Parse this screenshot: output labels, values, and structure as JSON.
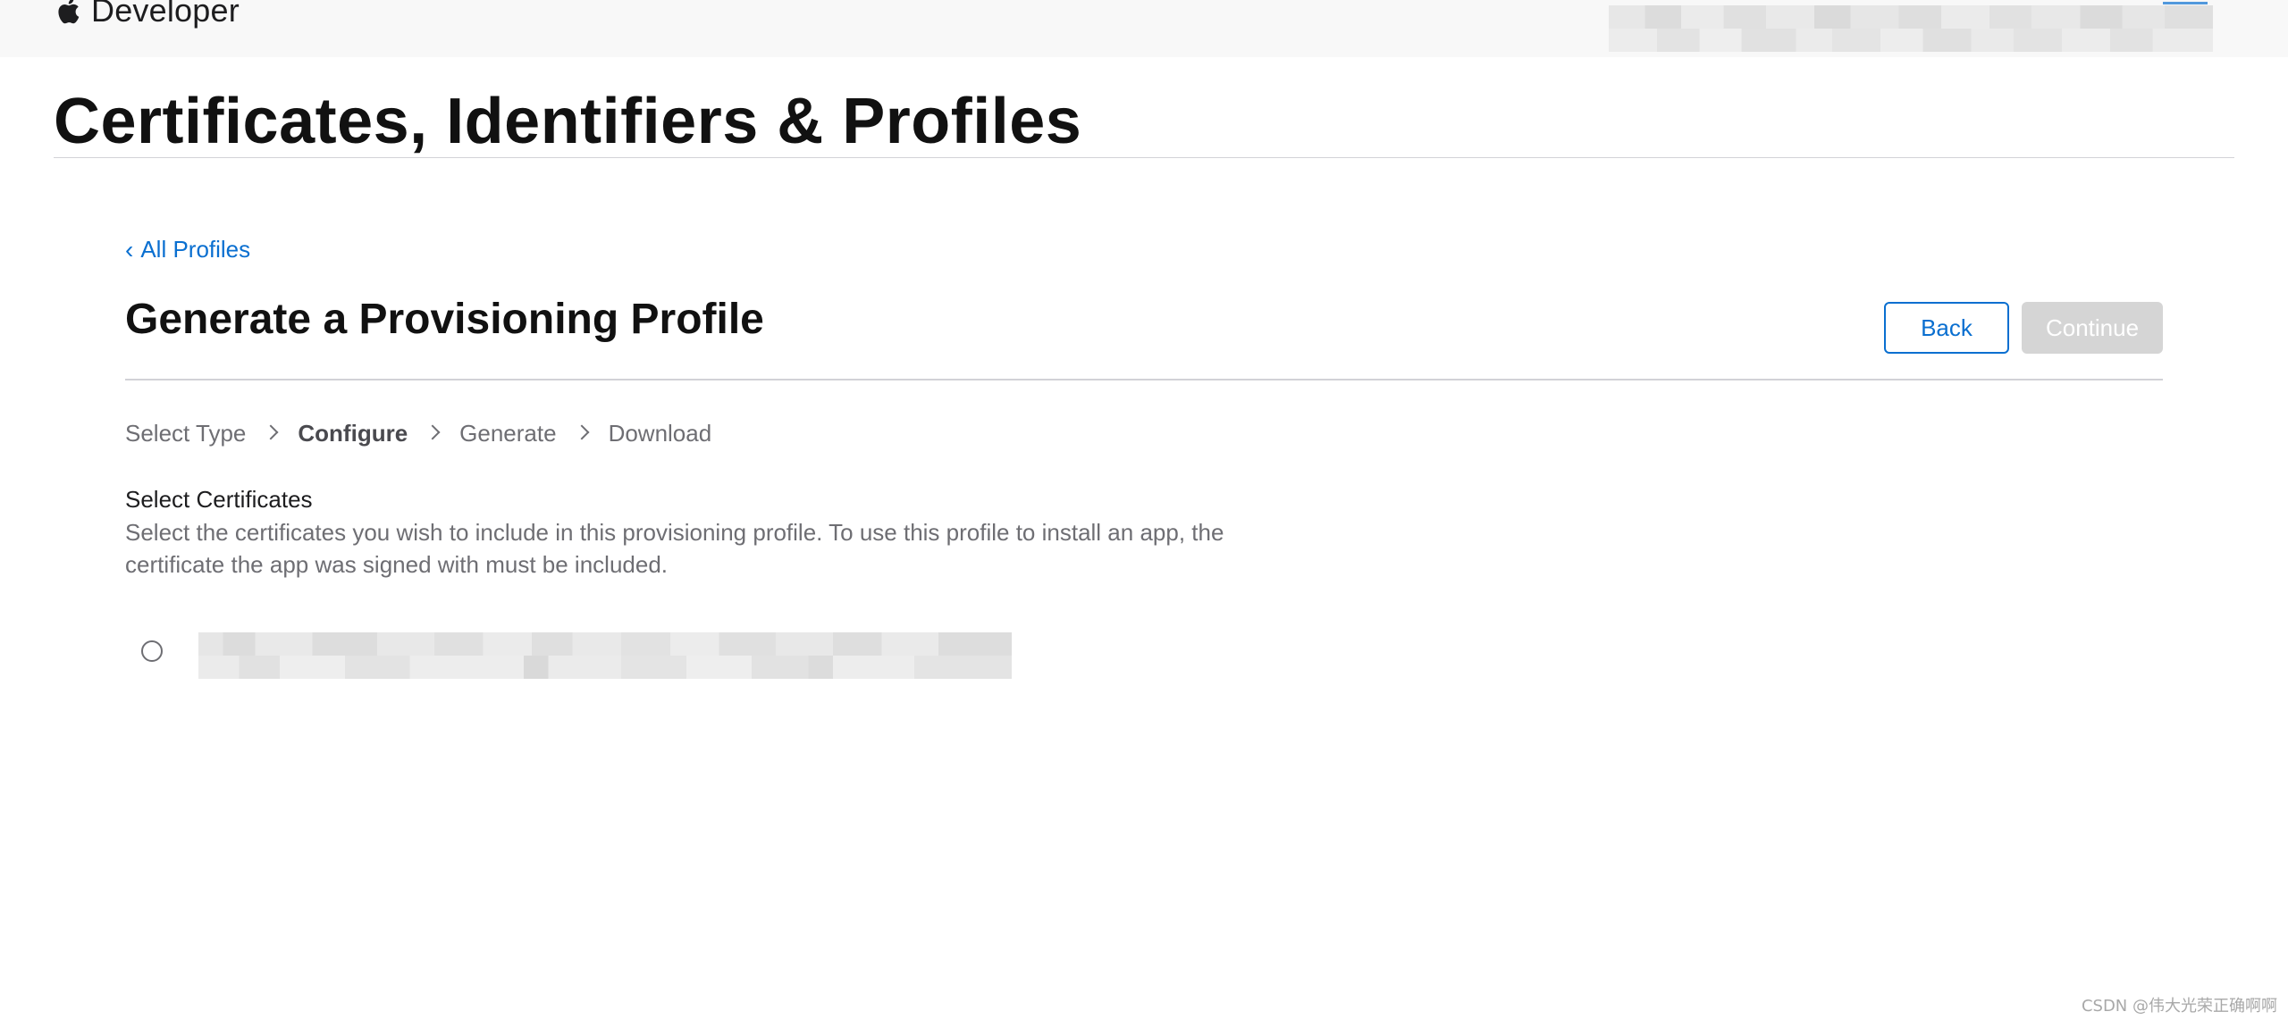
{
  "header": {
    "brand_label": "Developer",
    "logo_icon": "apple-logo-icon"
  },
  "page": {
    "title": "Certificates, Identifiers & Profiles"
  },
  "nav": {
    "back_link_label": "All Profiles",
    "back_link_icon": "chevron-left-icon"
  },
  "section": {
    "title": "Generate a Provisioning Profile"
  },
  "actions": {
    "back_label": "Back",
    "continue_label": "Continue",
    "continue_enabled": false,
    "accent_color": "#0a6fd0",
    "disabled_color": "#d5d5d5"
  },
  "steps": {
    "items": [
      "Select Type",
      "Configure",
      "Generate",
      "Download"
    ],
    "active_index": 1
  },
  "certificates": {
    "label": "Select Certificates",
    "description": "Select the certificates you wish to include in this provisioning profile. To use this profile to install an app, the certificate the app was signed with must be included.",
    "items": [
      {
        "selected": false,
        "name_obscured": true
      }
    ]
  },
  "watermark": {
    "text": "CSDN @伟大光荣正确啊啊"
  }
}
